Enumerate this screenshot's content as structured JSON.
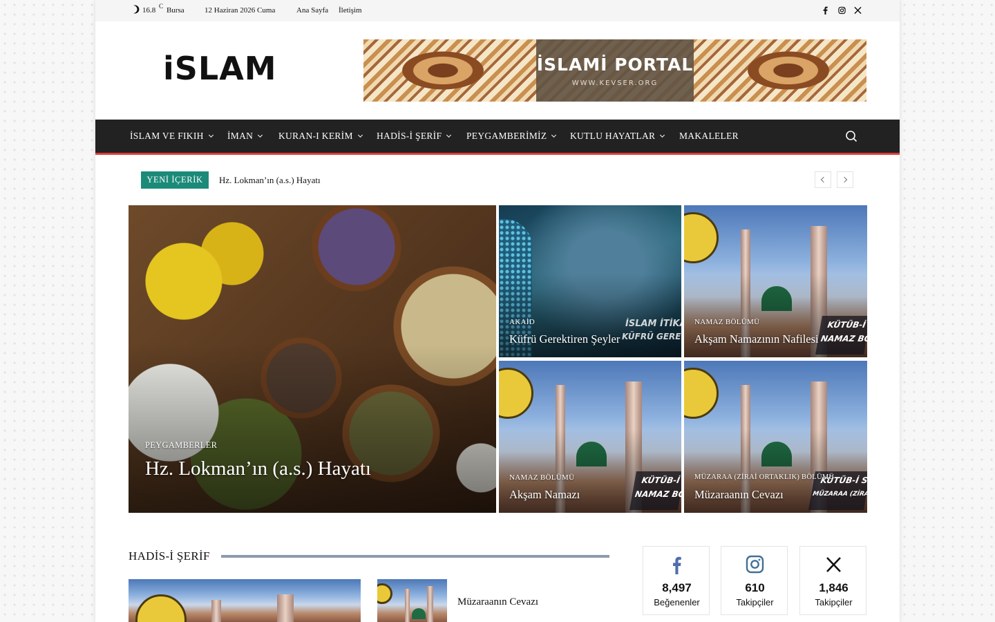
{
  "topbar": {
    "temperature": "16.8",
    "unit": "C",
    "city": "Bursa",
    "date": "12 Haziran 2026 Cuma",
    "links": [
      "Ana Sayfa",
      "İletişim"
    ]
  },
  "logo": {
    "text": "iSLAM"
  },
  "banner": {
    "title": "İSLAMİ PORTAL",
    "url_text": "WWW.KEVSER.ORG"
  },
  "nav": {
    "items": [
      "İSLAM VE FIKIH",
      "İMAN",
      "KURAN-I KERİM",
      "HADİS-İ ŞERİF",
      "PEYGAMBERİMİZ",
      "KUTLU HAYATLAR",
      "MAKALELER"
    ]
  },
  "ticker": {
    "badge": "YENİ İÇERİK",
    "headline": "Hz. Lokman’ın (a.s.) Hayatı"
  },
  "featured": {
    "main": {
      "category": "PEYGAMBERLER",
      "title": "Hz. Lokman’ın (a.s.) Hayatı"
    },
    "tiles": [
      {
        "category": "AKAİD",
        "title": "Küfrü Gerektiren Şeyler",
        "stamp": [
          "İSLAM İTİKAT",
          "KÜFRÜ GEREKTİ"
        ]
      },
      {
        "category": "NAMAZ BÖLÜMÜ",
        "title": "Akşam Namazının Nafilesi",
        "stamp": [
          "KÜTÜB-İ S",
          "NAMAZ BÖ"
        ]
      },
      {
        "category": "NAMAZ BÖLÜMÜ",
        "title": "Akşam Namazı",
        "stamp": [
          "KÜTÜB-İ",
          "NAMAZ BÖ"
        ]
      },
      {
        "category": "MÜZARAA (ZİRAİ ORTAKLIK) BÖLÜMÜ",
        "title": "Müzaraanın Cevazı",
        "stamp": [
          "KÜTÜB-İ S",
          "MÜZARAA (ZİRAİ ORTA"
        ]
      }
    ]
  },
  "section": {
    "title": "HADİS-İ ŞERİF",
    "side_item": "Müzaraanın Cevazı"
  },
  "social": [
    {
      "icon": "facebook-icon",
      "count": "8,497",
      "label": "Beğenenler"
    },
    {
      "icon": "instagram-icon",
      "count": "610",
      "label": "Takipçiler"
    },
    {
      "icon": "x-icon",
      "count": "1,846",
      "label": "Takipçiler"
    }
  ],
  "colors": {
    "nav_bg": "#222222",
    "nav_accent": "#d93b3b",
    "badge": "#1b8a79",
    "section_line": "#8d9aa9"
  }
}
